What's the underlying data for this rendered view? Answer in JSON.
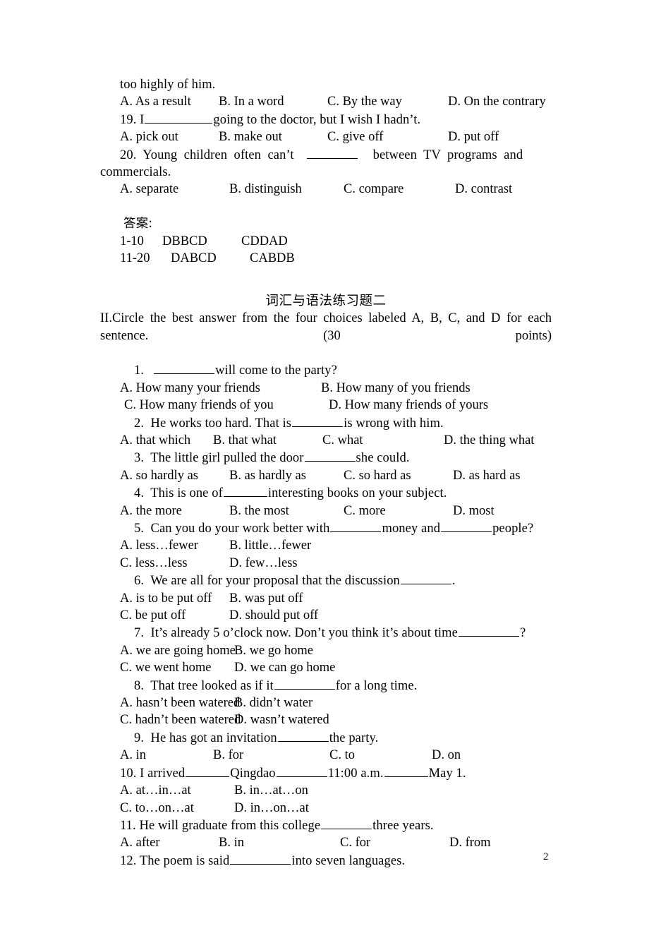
{
  "document": {
    "page_number": "2",
    "section_heading_cn": "词汇与语法练习题二",
    "answer_label_cn": "答案:"
  },
  "top_carryover": {
    "continuation_line": "too highly of him.",
    "q18_options": [
      "A. As a result",
      "B. In a word",
      "C. By the way",
      "D. On the contrary"
    ],
    "q19_text_before": "19. I",
    "q19_text_after": "going to the doctor, but I wish I hadn’t.",
    "q19_options": [
      "A. pick out",
      "B. make out",
      "C. give off",
      "D. put off"
    ],
    "q20_text_a": "20.  Young  children  often  can’t",
    "q20_text_b": "between  TV  programs  and",
    "q20_text_c": "commercials.",
    "q20_options": [
      "A. separate",
      "B. distinguish",
      "C. compare",
      "D. contrast"
    ]
  },
  "answer_key": {
    "rows": [
      {
        "range": "1-10",
        "first": "DBBCD",
        "second": "CDDAD"
      },
      {
        "range": "11-20",
        "first": "DABCD",
        "second": "CABDB"
      }
    ]
  },
  "instruction": {
    "text": "II.Circle the best answer from the four choices labeled A, B, C, and D for each sentence. (30 points)"
  },
  "questions": [
    {
      "number": "1.",
      "stem_before": "",
      "stem_after": "will come to the party?",
      "blank": "lg",
      "options_layout": "two-by-two",
      "options": [
        "A. How many your friends",
        "B. How many of you friends",
        "C. How many friends of you",
        "D. How many friends of yours"
      ]
    },
    {
      "number": "2.",
      "stem_before": "He works too hard. That is",
      "stem_after": "is wrong with him.",
      "blank": "md",
      "options_layout": "four-col",
      "options": [
        "A. that which",
        "B. that what",
        "C. what",
        "D. the thing what"
      ]
    },
    {
      "number": "3.",
      "stem_before": "The little girl pulled the door",
      "stem_after": "she could.",
      "blank": "md",
      "options_layout": "four-col",
      "options": [
        "A. so hardly as",
        "B. as hardly as",
        "C. so hard as",
        "D. as hard as"
      ]
    },
    {
      "number": "4.",
      "stem_before": "This is one of",
      "stem_after": "interesting books on your subject.",
      "blank": "sm",
      "options_layout": "four-col",
      "options": [
        "A. the more",
        "B. the most",
        "C. more",
        "D. most"
      ]
    },
    {
      "number": "5.",
      "stem_before": "Can you do your work better with",
      "stem_mid": "money and",
      "stem_after": "people?",
      "blank": "sm",
      "options_layout": "two-by-two-narrow",
      "options": [
        "A. less…fewer",
        "B. little…fewer",
        "C. less…less",
        "D. few…less"
      ]
    },
    {
      "number": "6.",
      "stem_before": "We are all for your proposal that the discussion",
      "stem_after": ".",
      "blank": "sm",
      "options_layout": "two-by-two-narrow",
      "options": [
        "A. is to be put off",
        "B. was put off",
        "C. be put off",
        "D. should put off"
      ]
    },
    {
      "number": "7.",
      "stem_before": "It’s already 5 o’clock now. Don’t you think it’s about time",
      "stem_after": "?",
      "blank": "lg",
      "options_layout": "two-by-two-narrow",
      "options": [
        "A. we are going home",
        "B. we go home",
        "C. we went home",
        "D. we can go home"
      ]
    },
    {
      "number": "8.",
      "stem_before": "That tree looked as if it",
      "stem_after": "for a long time.",
      "blank": "lg",
      "options_layout": "two-by-two-narrow",
      "options": [
        "A. hasn’t been watered",
        "B. didn’t water",
        "C. hadn’t been watered",
        "D. wasn’t watered"
      ]
    },
    {
      "number": "9.",
      "stem_before": "He has got an invitation",
      "stem_after": "the party.",
      "blank": "md",
      "options_layout": "four-col",
      "options": [
        "A. in",
        "B. for",
        "C. to",
        "D. on"
      ]
    },
    {
      "number": "10.",
      "stem_before": "I arrived",
      "stem_mid": "Qingdao",
      "stem_mid2": "11:00 a.m.",
      "stem_after": "May 1.",
      "blank": "sm",
      "options_layout": "two-by-two-narrow",
      "options": [
        "A. at…in…at",
        "B. in…at…on",
        "C. to…on…at",
        "D. in…on…at"
      ]
    },
    {
      "number": "11.",
      "stem_before": "He will graduate from this college",
      "stem_after": "three years.",
      "blank": "md",
      "options_layout": "four-col",
      "options": [
        "A. after",
        "B. in",
        "C. for",
        "D. from"
      ]
    },
    {
      "number": "12.",
      "stem_before": "The poem is said",
      "stem_after": "into seven languages.",
      "blank": "lg",
      "options_layout": "none",
      "options": []
    }
  ]
}
